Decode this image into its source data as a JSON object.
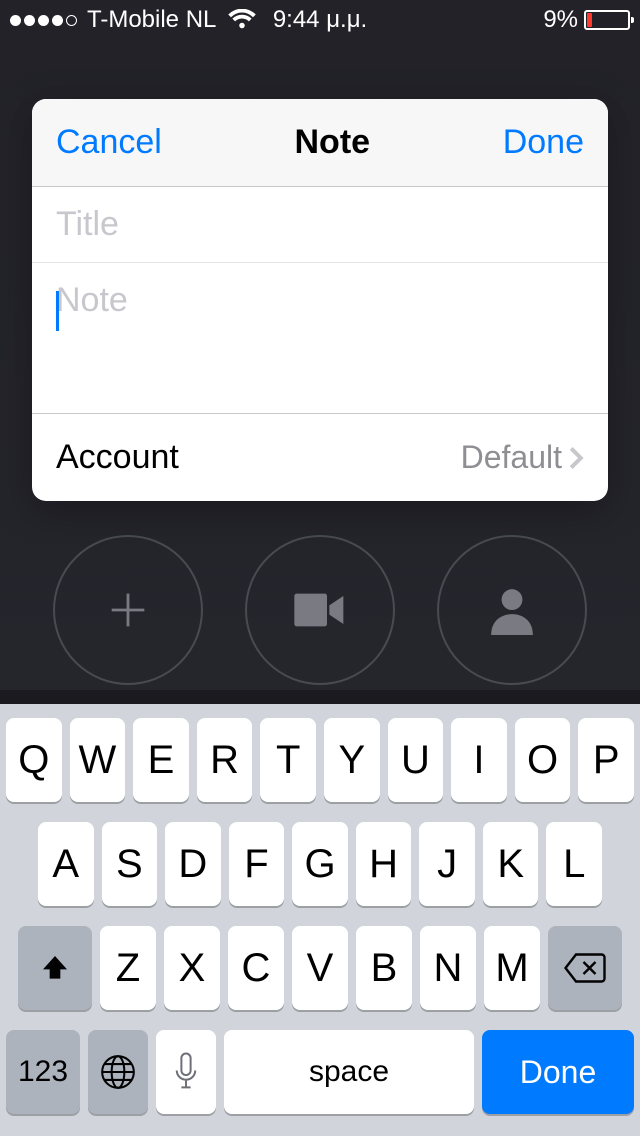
{
  "statusbar": {
    "carrier": "T-Mobile NL",
    "time": "9:44 μ.μ.",
    "battery_pct": "9%"
  },
  "modal": {
    "cancel": "Cancel",
    "title": "Note",
    "done": "Done",
    "title_placeholder": "Title",
    "note_placeholder": "Note",
    "account_label": "Account",
    "account_value": "Default"
  },
  "keyboard": {
    "row1": [
      "Q",
      "W",
      "E",
      "R",
      "T",
      "Y",
      "U",
      "I",
      "O",
      "P"
    ],
    "row2": [
      "A",
      "S",
      "D",
      "F",
      "G",
      "H",
      "J",
      "K",
      "L"
    ],
    "row3": [
      "Z",
      "X",
      "C",
      "V",
      "B",
      "N",
      "M"
    ],
    "key_123": "123",
    "space": "space",
    "done": "Done"
  }
}
